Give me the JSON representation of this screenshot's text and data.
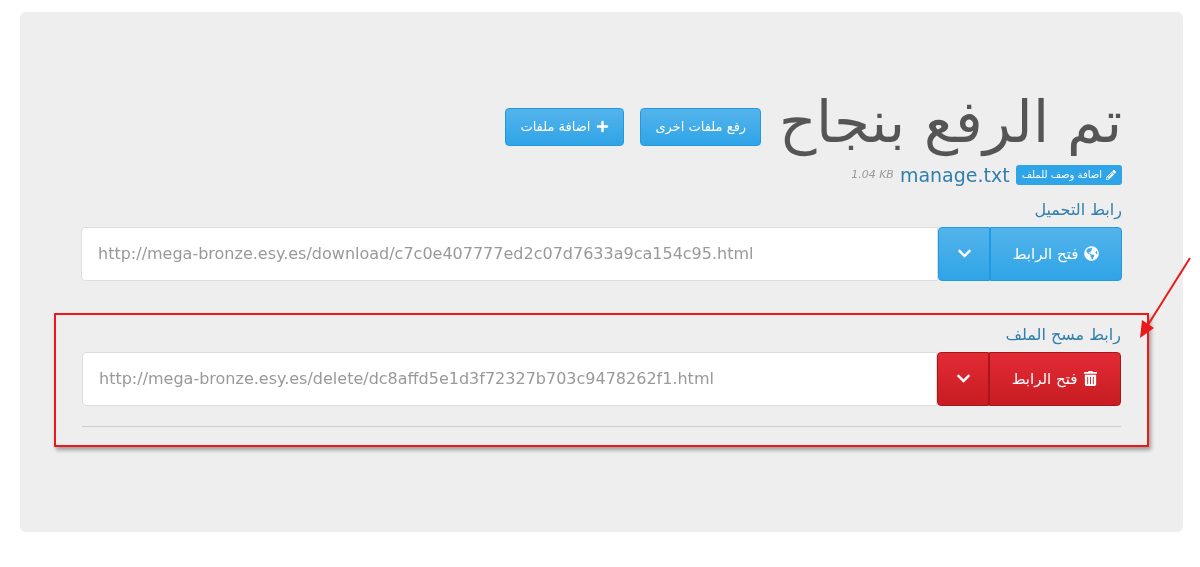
{
  "title": "تم الرفع بنجاح",
  "header_buttons": [
    {
      "label": "رفع ملفات اخرى",
      "kind": "plain"
    },
    {
      "label": "اضافة ملفات",
      "kind": "add"
    }
  ],
  "file": {
    "name": "manage.txt",
    "size": "1.04 KB",
    "description_button": "اضافة وصف للملف"
  },
  "links": [
    {
      "label": "رابط التحميل",
      "url": "http://mega-bronze.esy.es/download/c7c0e407777ed2c07d7633a9ca154c95.html",
      "button": "فتح الرابط",
      "kind": "download",
      "highlighted": false
    },
    {
      "label": "رابط مسح الملف",
      "url": "http://mega-bronze.esy.es/delete/dc8affd5e1d3f72327b703c9478262f1.html",
      "button": "فتح الرابط",
      "kind": "delete",
      "highlighted": true
    }
  ]
}
